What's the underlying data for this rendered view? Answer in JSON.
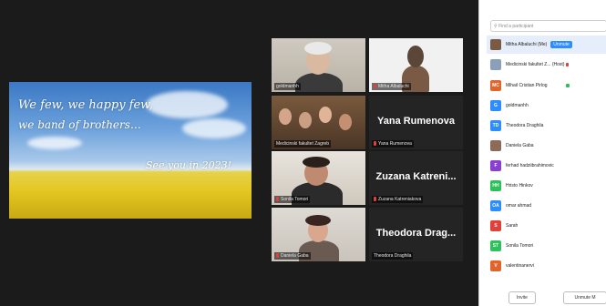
{
  "slide": {
    "line1": "We few, we happy few,",
    "line2": "we band of brothers…",
    "line3": "See you in 2023!"
  },
  "gallery": [
    {
      "name": "goldmanhh",
      "muted": false,
      "video": true,
      "active": true
    },
    {
      "name": "Mitha Albaluchi",
      "muted": true,
      "video": true,
      "active": false
    },
    {
      "name": "Medicinski fakultet Zagreb",
      "muted": false,
      "video": true,
      "active": false
    },
    {
      "name": "Yana Rumenova",
      "label": "Yana Rumenova",
      "muted": true,
      "video": false
    },
    {
      "name": "Sonila Tomori",
      "muted": true,
      "video": true
    },
    {
      "name": "Zuzana Katreni...",
      "label": "Zuzana Katreniakova",
      "muted": true,
      "video": false
    },
    {
      "name": "Daniela Gaba",
      "muted": true,
      "video": true
    },
    {
      "name": "Theodora Drag...",
      "label": "Theodora Draghila",
      "muted": false,
      "video": false
    }
  ],
  "participants": {
    "search_placeholder": "Find a participant",
    "list": [
      {
        "name": "Mitha Albaluchi (Me)",
        "initials": "",
        "color": "#7a5a44",
        "unmute": "Unmute"
      },
      {
        "name": "Medicinski fakultet Z... (Host)",
        "initials": "",
        "color": "#8aa0b8"
      },
      {
        "name": "Mihail Cristian Pirlog",
        "initials": "MC",
        "color": "#e0642b"
      },
      {
        "name": "goldmanhh",
        "initials": "G",
        "color": "#2d8cff"
      },
      {
        "name": "Theodora Draghila",
        "initials": "TD",
        "color": "#2d8cff"
      },
      {
        "name": "Daniela Gaba",
        "initials": "",
        "color": "#8b6b55"
      },
      {
        "name": "ferhad hadziibrahimovic",
        "initials": "F",
        "color": "#8a3fd1"
      },
      {
        "name": "Hristo Hinkov",
        "initials": "HH",
        "color": "#2ec05a"
      },
      {
        "name": "omar ahmad",
        "initials": "OA",
        "color": "#2d8cff"
      },
      {
        "name": "Sarah",
        "initials": "S",
        "color": "#e0403a"
      },
      {
        "name": "Sonila Tomori",
        "initials": "ST",
        "color": "#2ec05a"
      },
      {
        "name": "valentinanervi",
        "initials": "V",
        "color": "#e0642b"
      }
    ],
    "invite_label": "Invite",
    "unmute_me_label": "Unmute M"
  }
}
